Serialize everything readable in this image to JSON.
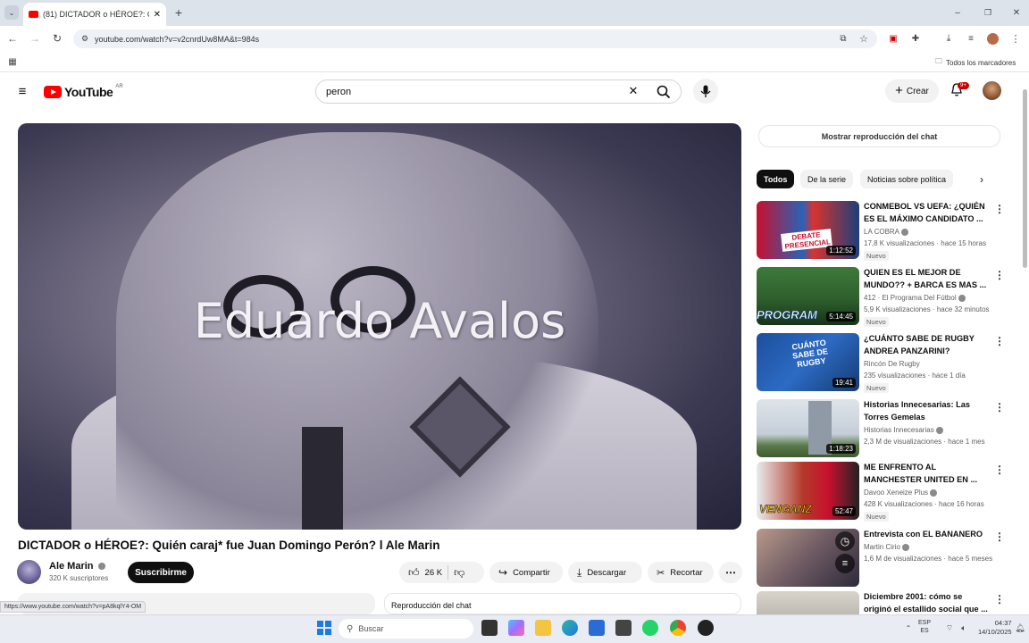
{
  "browser": {
    "tab_title": "(81) DICTADOR o HÉROE?: Quién",
    "url": "youtube.com/watch?v=v2cnrdUw8MA&t=984s",
    "bookmarks_label": "Todos los marcadores",
    "status_url": "https://www.youtube.com/watch?v=pA8kqlY4-OM"
  },
  "header": {
    "logo_text": "YouTube",
    "region": "AR",
    "search_value": "peron",
    "create_label": "Crear",
    "notif_badge": "9+"
  },
  "video": {
    "overlay_text": "Eduardo Avalos",
    "title": "DICTADOR o HÉROE?: Quién caraj* fue Juan Domingo Perón? l Ale Marin",
    "channel": "Ale Marin",
    "subscribers": "320 K suscriptores",
    "subscribe_label": "Suscribirme",
    "likes": "26 K",
    "share_label": "Compartir",
    "download_label": "Descargar",
    "clip_label": "Recortar",
    "chat_replay_label": "Reproducción del chat"
  },
  "sidebar": {
    "show_chat_label": "Mostrar reproducción del chat",
    "chips": [
      "Todos",
      "De la serie",
      "Noticias sobre política"
    ],
    "items": [
      {
        "title": "CONMEBOL VS UEFA: ¿QUIÉN ES EL MÁXIMO CANDIDATO ...",
        "channel": "LA COBRA",
        "views": "17,8 K visualizaciones · hace 15 horas",
        "badge": "Nuevo",
        "duration": "1:12:52",
        "thumb_text": "DEBATE PRESENCIAL"
      },
      {
        "title": "QUIEN ES EL MEJOR DE MUNDO?? + BARCA ES MAS ...",
        "channel": "412 · El Programa Del Fútbol",
        "views": "5,9 K visualizaciones · hace 32 minutos",
        "badge": "Nuevo",
        "duration": "5:14:45",
        "thumb_text": "PROGRAM"
      },
      {
        "title": "¿CUÁNTO SABE DE RUGBY ANDREA PANZARINI?",
        "channel": "Rincón De Rugby",
        "views": "235 visualizaciones · hace 1 día",
        "badge": "Nuevo",
        "duration": "19:41",
        "thumb_text": "CUÁNTO SABE DE RUGBY"
      },
      {
        "title": "Historias Innecesarias: Las Torres Gemelas",
        "channel": "Historias Innecesarias",
        "views": "2,3 M de visualizaciones · hace 1 mes",
        "badge": "",
        "duration": "1:18:23",
        "thumb_text": ""
      },
      {
        "title": "ME ENFRENTO AL MANCHESTER UNITED EN ...",
        "channel": "Davoo Xeneize Plus",
        "views": "428 K visualizaciones · hace 16 horas",
        "badge": "Nuevo",
        "duration": "52:47",
        "thumb_text": "VENGANZ"
      },
      {
        "title": "Entrevista con EL BANANERO",
        "channel": "Martin Cirio",
        "views": "1,6 M de visualizaciones · hace 5 meses",
        "badge": "",
        "duration": "",
        "thumb_text": ""
      },
      {
        "title": "Diciembre 2001: cómo se originó el estallido social que ...",
        "channel": "",
        "views": "",
        "badge": "",
        "duration": "",
        "thumb_text": ""
      }
    ]
  },
  "taskbar": {
    "search_placeholder": "Buscar",
    "lang": "ESP",
    "lang2": "ES",
    "time": "04:37",
    "date": "14/10/2025"
  }
}
